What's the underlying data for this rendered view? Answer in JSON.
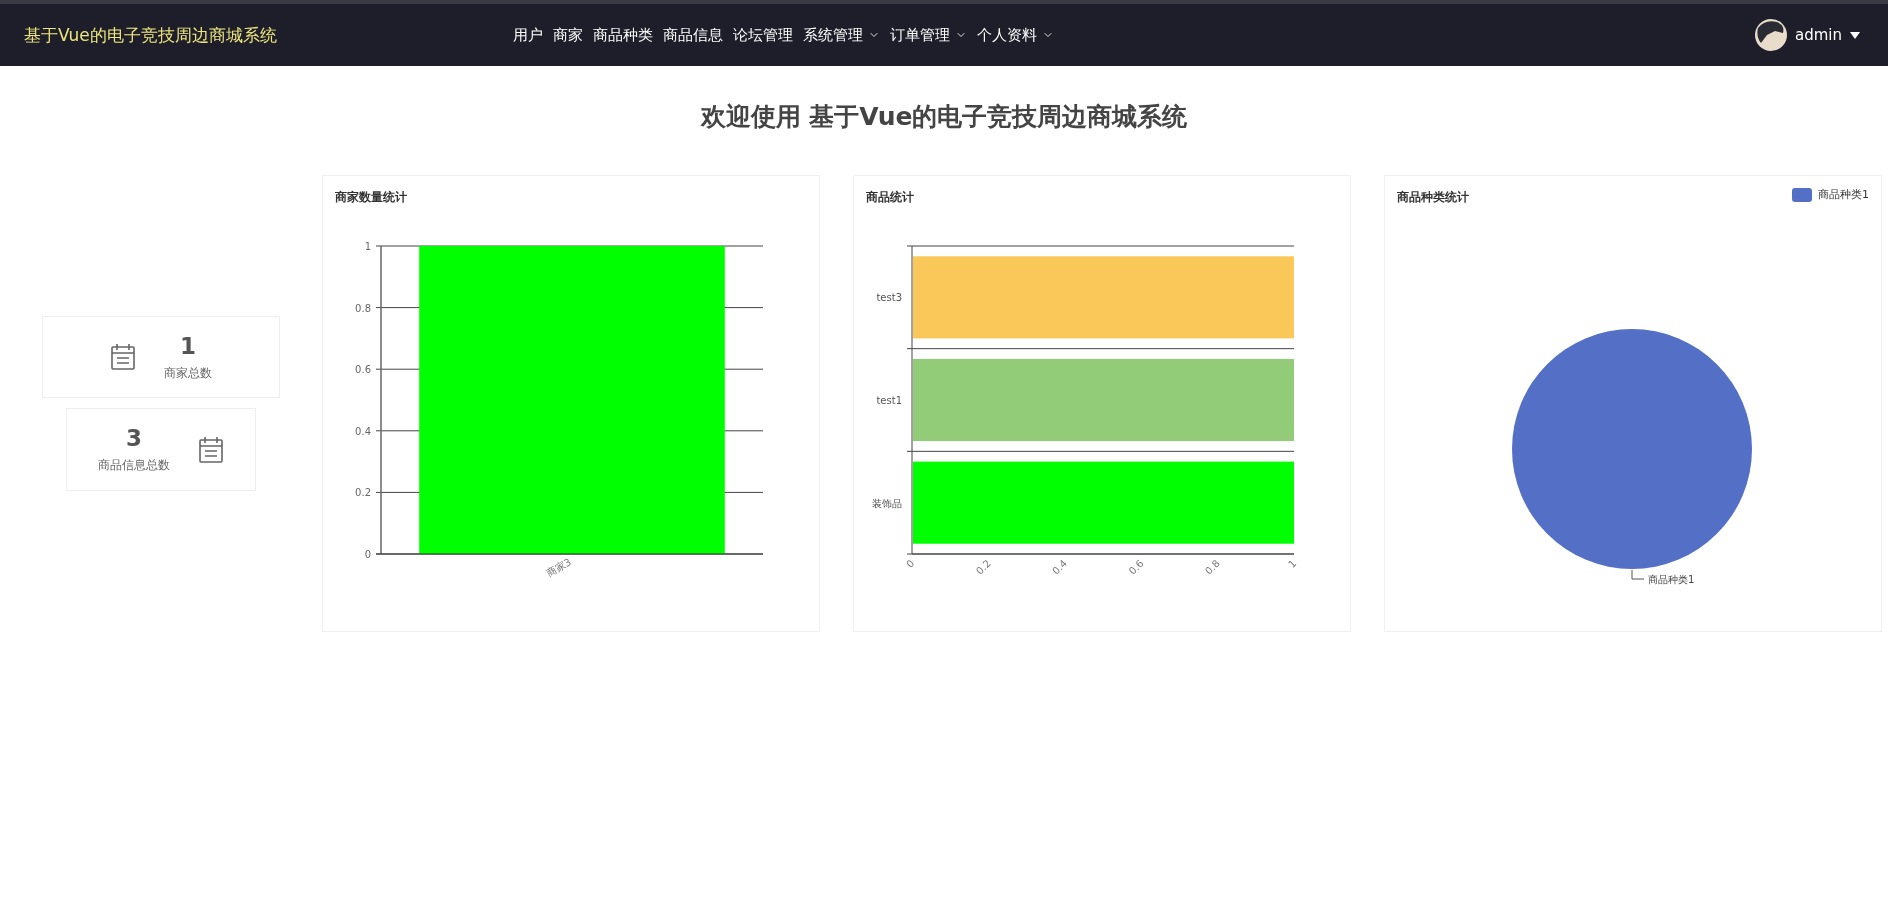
{
  "navbar": {
    "brand": "基于Vue的电子竞技周边商城系统",
    "menu": [
      {
        "label": "用户",
        "has_submenu": false
      },
      {
        "label": "商家",
        "has_submenu": false
      },
      {
        "label": "商品种类",
        "has_submenu": false
      },
      {
        "label": "商品信息",
        "has_submenu": false
      },
      {
        "label": "论坛管理",
        "has_submenu": false
      },
      {
        "label": "系统管理",
        "has_submenu": true
      },
      {
        "label": "订单管理",
        "has_submenu": true
      },
      {
        "label": "个人资料",
        "has_submenu": true
      }
    ],
    "user": {
      "name": "admin"
    }
  },
  "heading": "欢迎使用 基于Vue的电子竞技周边商城系统",
  "stats": [
    {
      "value": "1",
      "label": "商家总数",
      "kind": "iconleft"
    },
    {
      "value": "3",
      "label": "商品信息总数",
      "kind": "iconright"
    }
  ],
  "charts": [
    {
      "title": "商家数量统计",
      "chart_data": {
        "type": "bar",
        "orientation": "vertical",
        "categories": [
          "商家3"
        ],
        "series": [
          {
            "color": "#00ff00",
            "values": [
              1
            ]
          }
        ],
        "grid": true,
        "ylim": [
          0,
          1
        ],
        "yticks": [
          0,
          0.2,
          0.4,
          0.6,
          0.8,
          1
        ]
      }
    },
    {
      "title": "商品统计",
      "chart_data": {
        "type": "bar",
        "orientation": "horizontal",
        "categories": [
          "test3",
          "test1",
          "装饰品"
        ],
        "series": [
          {
            "color": "#fac858",
            "values": [
              1,
              null,
              null
            ]
          },
          {
            "color": "#93cc78",
            "values": [
              null,
              1,
              null
            ]
          },
          {
            "color": "#00ff00",
            "values": [
              null,
              null,
              1
            ]
          }
        ],
        "stacked": true,
        "grid": true,
        "xlim": [
          0,
          1
        ],
        "xticks": [
          0,
          0.2,
          0.4,
          0.6,
          0.8,
          1
        ]
      }
    },
    {
      "title": "商品种类统计",
      "chart_data": {
        "type": "pie",
        "categories": [
          "商品种类1"
        ],
        "series": [
          {
            "color": "#5470c6",
            "values": [
              1
            ]
          }
        ]
      }
    }
  ]
}
